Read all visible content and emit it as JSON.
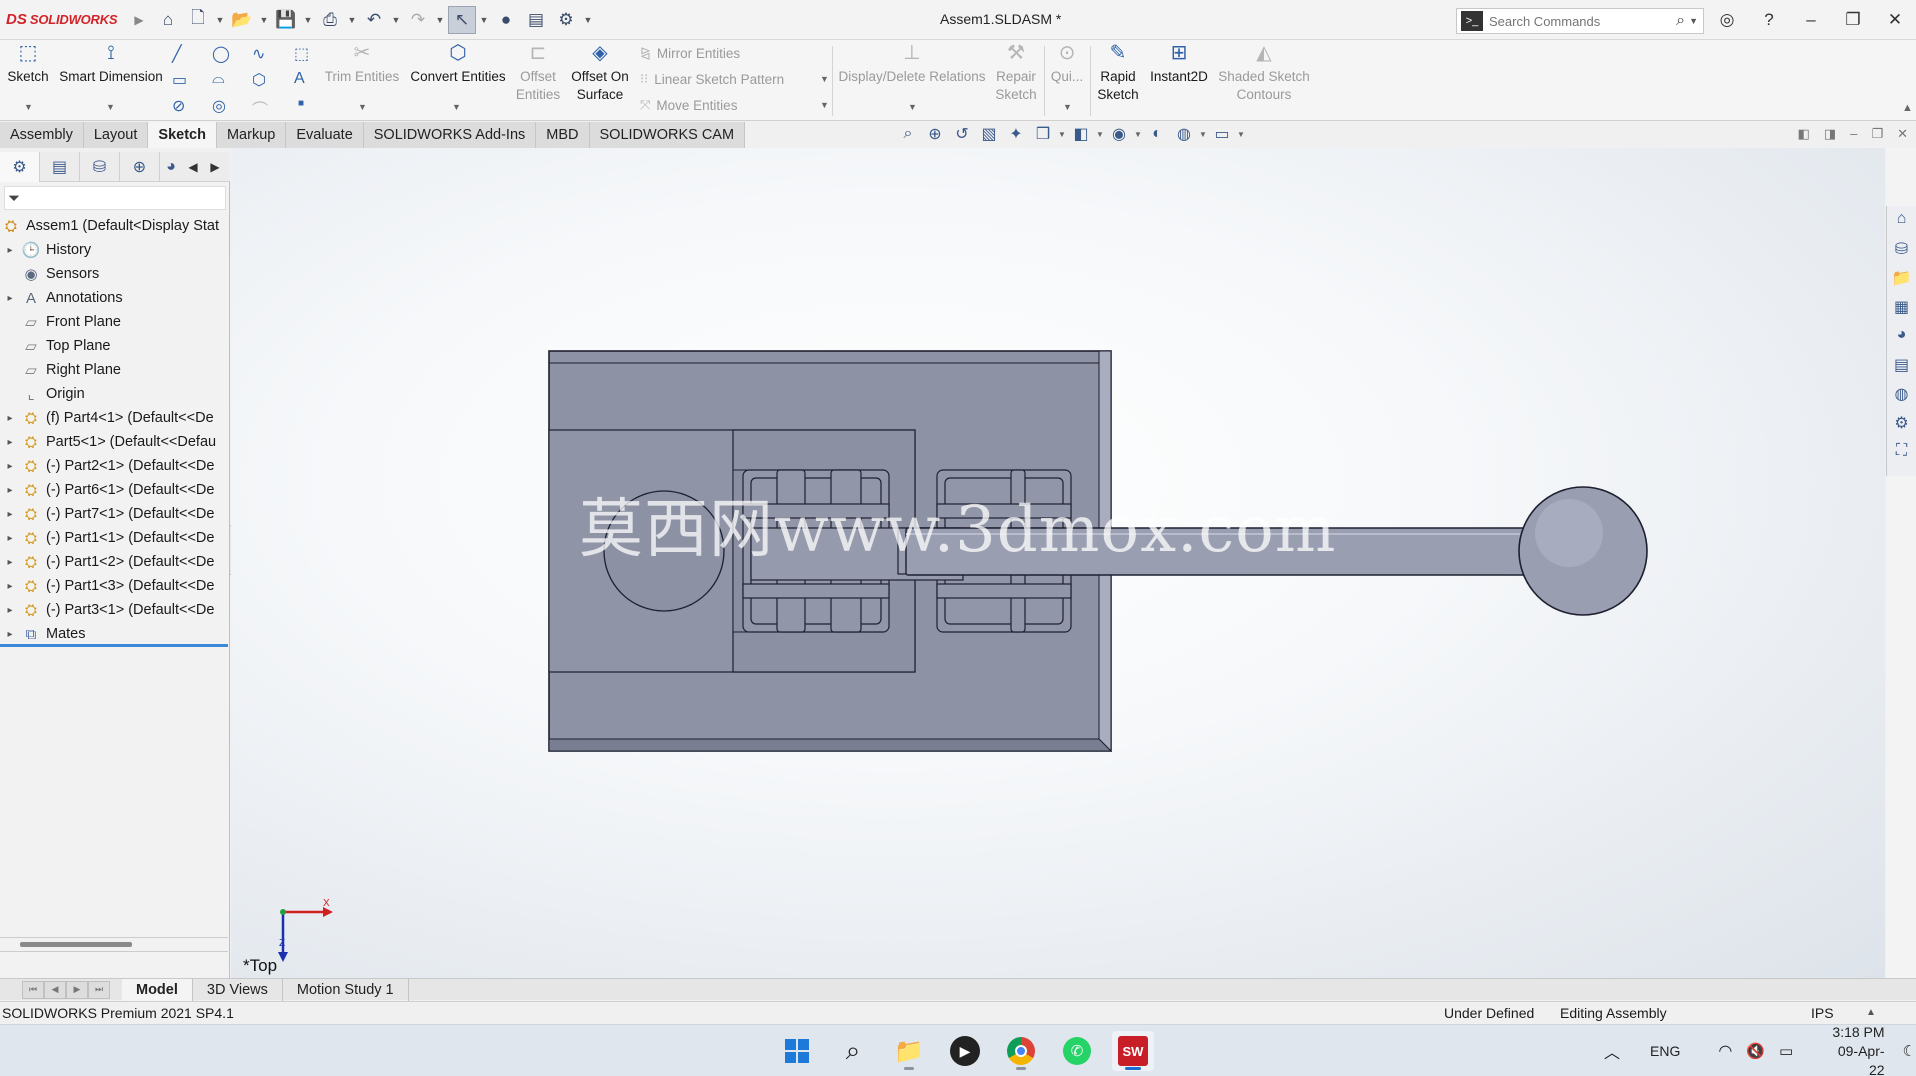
{
  "app": {
    "doc_title": "Assem1.SLDASM *",
    "logo_text": "SOLIDWORKS",
    "logo_mark": "DS"
  },
  "search": {
    "placeholder": "Search Commands"
  },
  "ribbon": {
    "sketch": "Sketch",
    "smart_dimension": "Smart Dimension",
    "trim_entities": "Trim Entities",
    "convert_entities": "Convert Entities",
    "offset_entities_1": "Offset",
    "offset_entities_2": "Entities",
    "offset_surface_1": "Offset On",
    "offset_surface_2": "Surface",
    "mirror_entities": "Mirror Entities",
    "linear_pattern": "Linear Sketch Pattern",
    "move_entities": "Move Entities",
    "display_delete_relations": "Display/Delete Relations",
    "repair_sketch_1": "Repair",
    "repair_sketch_2": "Sketch",
    "quick_snaps": "Qui...",
    "rapid_sketch_1": "Rapid",
    "rapid_sketch_2": "Sketch",
    "instant2d": "Instant2D",
    "shaded_contours_1": "Shaded Sketch",
    "shaded_contours_2": "Contours"
  },
  "tabs": [
    "Assembly",
    "Layout",
    "Sketch",
    "Markup",
    "Evaluate",
    "SOLIDWORKS Add-Ins",
    "MBD",
    "SOLIDWORKS CAM"
  ],
  "active_tab": "Sketch",
  "tree": {
    "root": "Assem1  (Default<Display Stat",
    "items": [
      {
        "label": "History",
        "expandable": true,
        "icon": "history-folder-icon"
      },
      {
        "label": "Sensors",
        "expandable": false,
        "icon": "sensor-icon"
      },
      {
        "label": "Annotations",
        "expandable": true,
        "icon": "annotation-icon"
      },
      {
        "label": "Front Plane",
        "expandable": false,
        "icon": "plane-icon"
      },
      {
        "label": "Top Plane",
        "expandable": false,
        "icon": "plane-icon"
      },
      {
        "label": "Right Plane",
        "expandable": false,
        "icon": "plane-icon"
      },
      {
        "label": "Origin",
        "expandable": false,
        "icon": "origin-icon"
      },
      {
        "label": "(f) Part4<1> (Default<<De",
        "expandable": true,
        "icon": "part-icon"
      },
      {
        "label": "Part5<1> (Default<<Defau",
        "expandable": true,
        "icon": "part-icon"
      },
      {
        "label": "(-) Part2<1> (Default<<De",
        "expandable": true,
        "icon": "part-icon"
      },
      {
        "label": "(-) Part6<1> (Default<<De",
        "expandable": true,
        "icon": "part-icon"
      },
      {
        "label": "(-) Part7<1> (Default<<De",
        "expandable": true,
        "icon": "part-icon"
      },
      {
        "label": "(-) Part1<1> (Default<<De",
        "expandable": true,
        "icon": "part-icon"
      },
      {
        "label": "(-) Part1<2> (Default<<De",
        "expandable": true,
        "icon": "part-icon"
      },
      {
        "label": "(-) Part1<3> (Default<<De",
        "expandable": true,
        "icon": "part-icon"
      },
      {
        "label": "(-) Part3<1> (Default<<De",
        "expandable": true,
        "icon": "part-icon"
      },
      {
        "label": "Mates",
        "expandable": true,
        "icon": "mates-icon"
      }
    ]
  },
  "viewport": {
    "view_label": "*Top",
    "watermark": "莫西网www.3dmox.com",
    "axis_x": "X",
    "axis_z": "Z"
  },
  "bottom_tabs": [
    "Model",
    "3D Views",
    "Motion Study 1"
  ],
  "active_bottom_tab": "Model",
  "status": {
    "version": "SOLIDWORKS Premium 2021 SP4.1",
    "sketch_state": "Under Defined",
    "mode": "Editing Assembly",
    "units": "IPS"
  },
  "taskbar": {
    "lang": "ENG",
    "time": "3:18 PM",
    "date": "09-Apr-22"
  },
  "colors": {
    "accent": "#2f62a8",
    "part_fill": "#8f93a6",
    "part_stroke": "#1e2030",
    "logo": "#d2232a"
  }
}
